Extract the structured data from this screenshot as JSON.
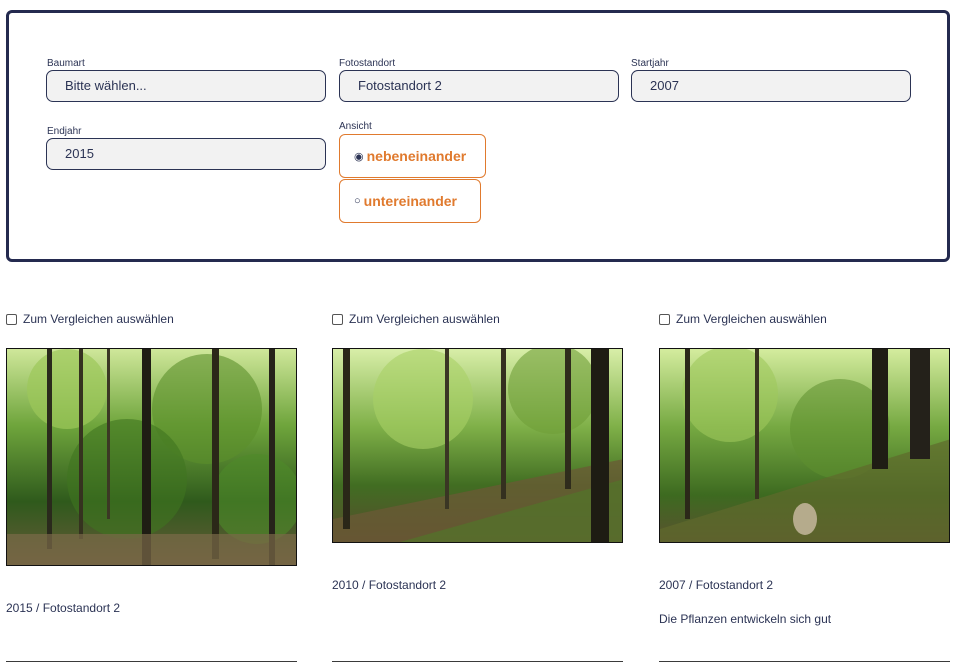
{
  "filters": {
    "baumart": {
      "label": "Baumart",
      "value": "Bitte wählen..."
    },
    "fotostandort": {
      "label": "Fotostandort",
      "value": "Fotostandort 2"
    },
    "startjahr": {
      "label": "Startjahr",
      "value": "2007"
    },
    "endjahr": {
      "label": "Endjahr",
      "value": "2015"
    },
    "ansicht": {
      "label": "Ansicht",
      "options": [
        {
          "label": "nebeneinander",
          "selected": true,
          "icon": "◉"
        },
        {
          "label": "untereinander",
          "selected": false,
          "icon": "○"
        }
      ]
    }
  },
  "cards": [
    {
      "compare_label": "Zum Vergleichen auswählen",
      "caption": "2015 / Fotostandort 2",
      "description": ""
    },
    {
      "compare_label": "Zum Vergleichen auswählen",
      "caption": "2010 / Fotostandort 2",
      "description": ""
    },
    {
      "compare_label": "Zum Vergleichen auswählen",
      "caption": "2007 / Fotostandort 2",
      "description": "Die Pflanzen entwickeln sich gut"
    }
  ],
  "colors": {
    "navy": "#242a4f",
    "accent": "#e07a2e",
    "field_bg": "#f2f2f2"
  }
}
